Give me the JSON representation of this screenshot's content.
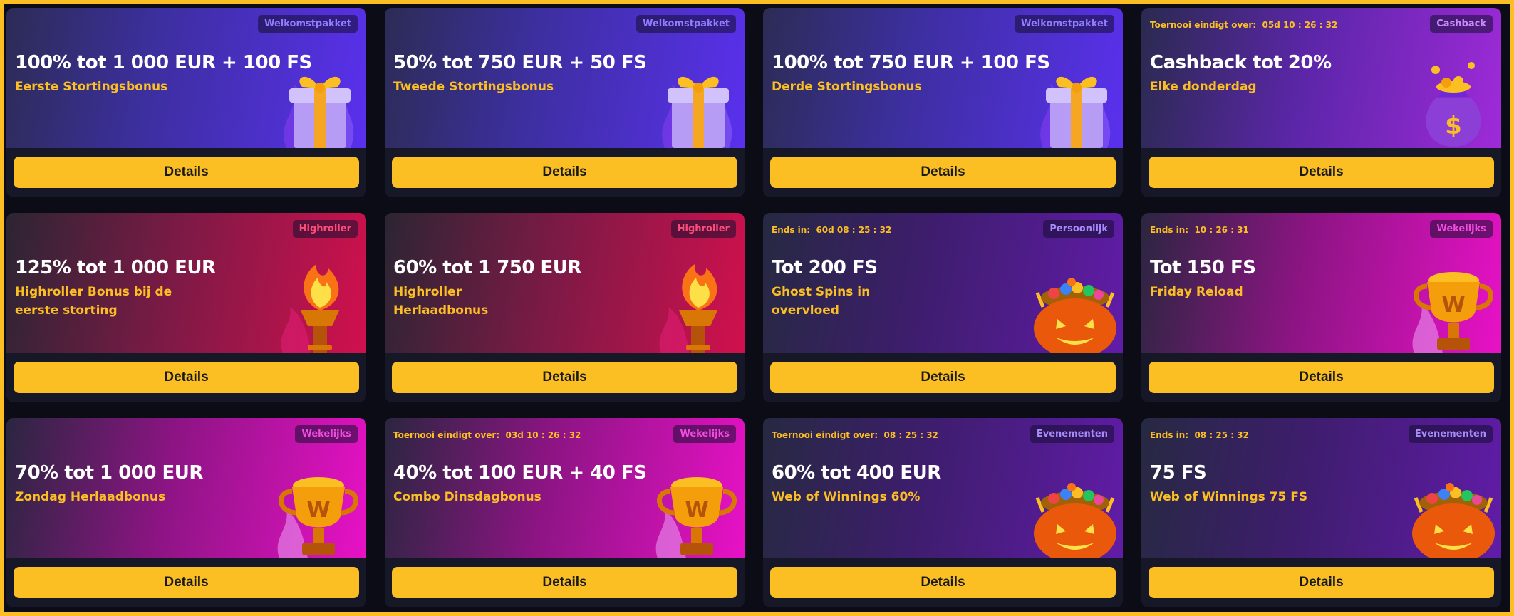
{
  "cards": [
    {
      "tag": "Welkomstpakket",
      "tag_color": "#8f7cff",
      "timer": "",
      "title": "100% tot 1 000 EUR + 100 FS",
      "subtitle": "Eerste Stortingsbonus",
      "button": "Details",
      "theme": "purple",
      "art": "gift-icon"
    },
    {
      "tag": "Welkomstpakket",
      "tag_color": "#8f7cff",
      "timer": "",
      "title": "50% tot 750 EUR + 50 FS",
      "subtitle": "Tweede Stortingsbonus",
      "button": "Details",
      "theme": "purple",
      "art": "gift-icon"
    },
    {
      "tag": "Welkomstpakket",
      "tag_color": "#8f7cff",
      "timer": "",
      "title": "100% tot 750 EUR + 100 FS",
      "subtitle": "Derde Stortingsbonus",
      "button": "Details",
      "theme": "purple",
      "art": "gift-icon"
    },
    {
      "tag": "Cashback",
      "tag_color": "#c98cff",
      "timer": "Toernooi eindigt over:  05d 10 : 26 : 32",
      "title": "Cashback tot 20%",
      "subtitle": "Elke donderdag",
      "button": "Details",
      "theme": "violet",
      "art": "money-bag-icon"
    },
    {
      "tag": "Highroller",
      "tag_color": "#ff4d7a",
      "timer": "",
      "title": "125% tot 1 000 EUR",
      "subtitle": "Highroller Bonus bij de eerste storting",
      "button": "Details",
      "theme": "red",
      "art": "torch-icon"
    },
    {
      "tag": "Highroller",
      "tag_color": "#ff4d7a",
      "timer": "",
      "title": "60% tot 1 750 EUR",
      "subtitle": "Highroller Herlaadbonus",
      "button": "Details",
      "theme": "red",
      "art": "torch-icon"
    },
    {
      "tag": "Persoonlijk",
      "tag_color": "#a78bfa",
      "timer": "Ends in:  60d 08 : 25 : 32",
      "title": "Tot 200 FS",
      "subtitle": "Ghost Spins in overvloed",
      "button": "Details",
      "theme": "grape",
      "art": "pumpkin-icon"
    },
    {
      "tag": "Wekelijks",
      "tag_color": "#f04de0",
      "timer": "Ends in:  10 : 26 : 31",
      "title": "Tot 150 FS",
      "subtitle": "Friday Reload",
      "button": "Details",
      "theme": "magenta",
      "art": "trophy-icon"
    },
    {
      "tag": "Wekelijks",
      "tag_color": "#f04de0",
      "timer": "",
      "title": "70% tot 1 000 EUR",
      "subtitle": "Zondag Herlaadbonus",
      "button": "Details",
      "theme": "magenta",
      "art": "trophy-icon"
    },
    {
      "tag": "Wekelijks",
      "tag_color": "#f04de0",
      "timer": "Toernooi eindigt over:  03d 10 : 26 : 32",
      "title": "40% tot 100 EUR + 40 FS",
      "subtitle": "Combo Dinsdagbonus",
      "button": "Details",
      "theme": "magenta",
      "art": "trophy-icon"
    },
    {
      "tag": "Evenementen",
      "tag_color": "#a78bfa",
      "timer": "Toernooi eindigt over:  08 : 25 : 32",
      "title": "60% tot 400 EUR",
      "subtitle": "Web of Winnings 60%",
      "button": "Details",
      "theme": "grape",
      "art": "pumpkin-icon"
    },
    {
      "tag": "Evenementen",
      "tag_color": "#a78bfa",
      "timer": "Ends in:  08 : 25 : 32",
      "title": "75 FS",
      "subtitle": "Web of Winnings 75 FS",
      "button": "Details",
      "theme": "grape",
      "art": "pumpkin-icon"
    }
  ]
}
